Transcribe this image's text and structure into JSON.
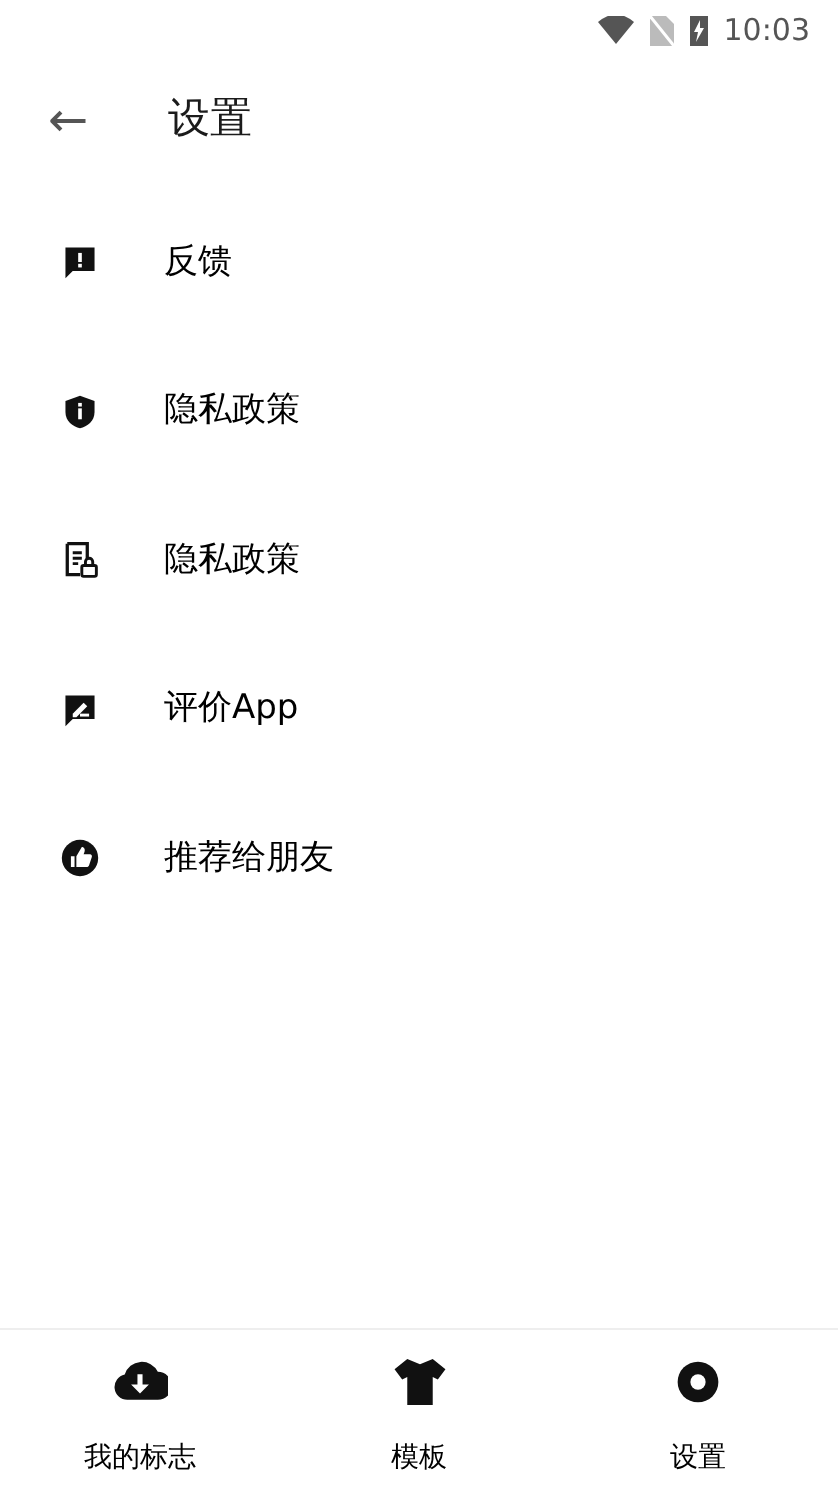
{
  "status_bar": {
    "time": "10:03"
  },
  "header": {
    "back": "←",
    "title": "设置"
  },
  "menu": [
    {
      "label": "反馈"
    },
    {
      "label": "隐私政策"
    },
    {
      "label": "隐私政策"
    },
    {
      "label": "评价App"
    },
    {
      "label": "推荐给朋友"
    }
  ],
  "bottom_nav": [
    {
      "label": "我的标志"
    },
    {
      "label": "模板"
    },
    {
      "label": "设置"
    }
  ]
}
